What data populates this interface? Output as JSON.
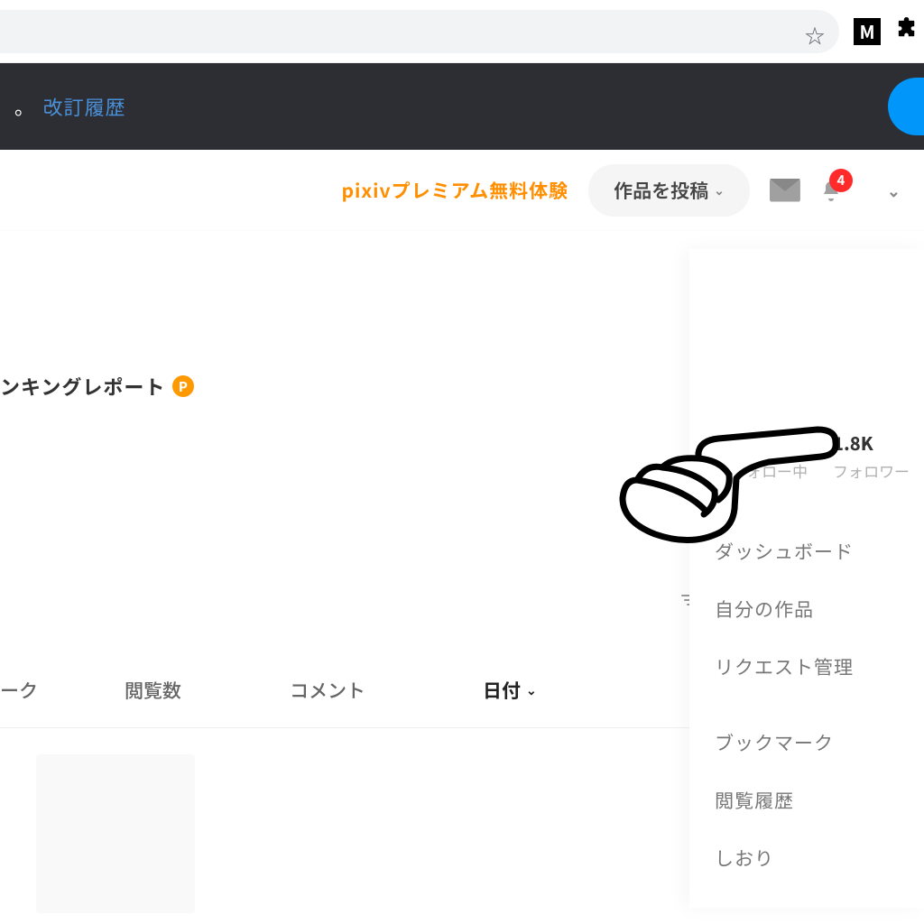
{
  "browser": {
    "star_icon": "☆",
    "ext_m": "M",
    "ext_puzzle": "⊞"
  },
  "banner": {
    "punct": "。",
    "revision_link": "改訂履歴"
  },
  "toolbar": {
    "premium": "pixivプレミアム無料体験",
    "post_label": "作品を投稿",
    "badge_count": "4"
  },
  "rank_report": {
    "text": "ンキングレポート",
    "p": "P"
  },
  "columns": {
    "mark": "ーク",
    "views": "閲覧数",
    "comments": "コメント",
    "date": "日付"
  },
  "panel": {
    "following_label": "ォロー中",
    "followers_count": "1.8K",
    "followers_label": "フォロワー",
    "menu": {
      "dashboard": "ダッシュボード",
      "my_works": "自分の作品",
      "request_mgmt": "リクエスト管理",
      "bookmarks": "ブックマーク",
      "history": "閲覧履歴",
      "shiori": "しおり"
    }
  }
}
